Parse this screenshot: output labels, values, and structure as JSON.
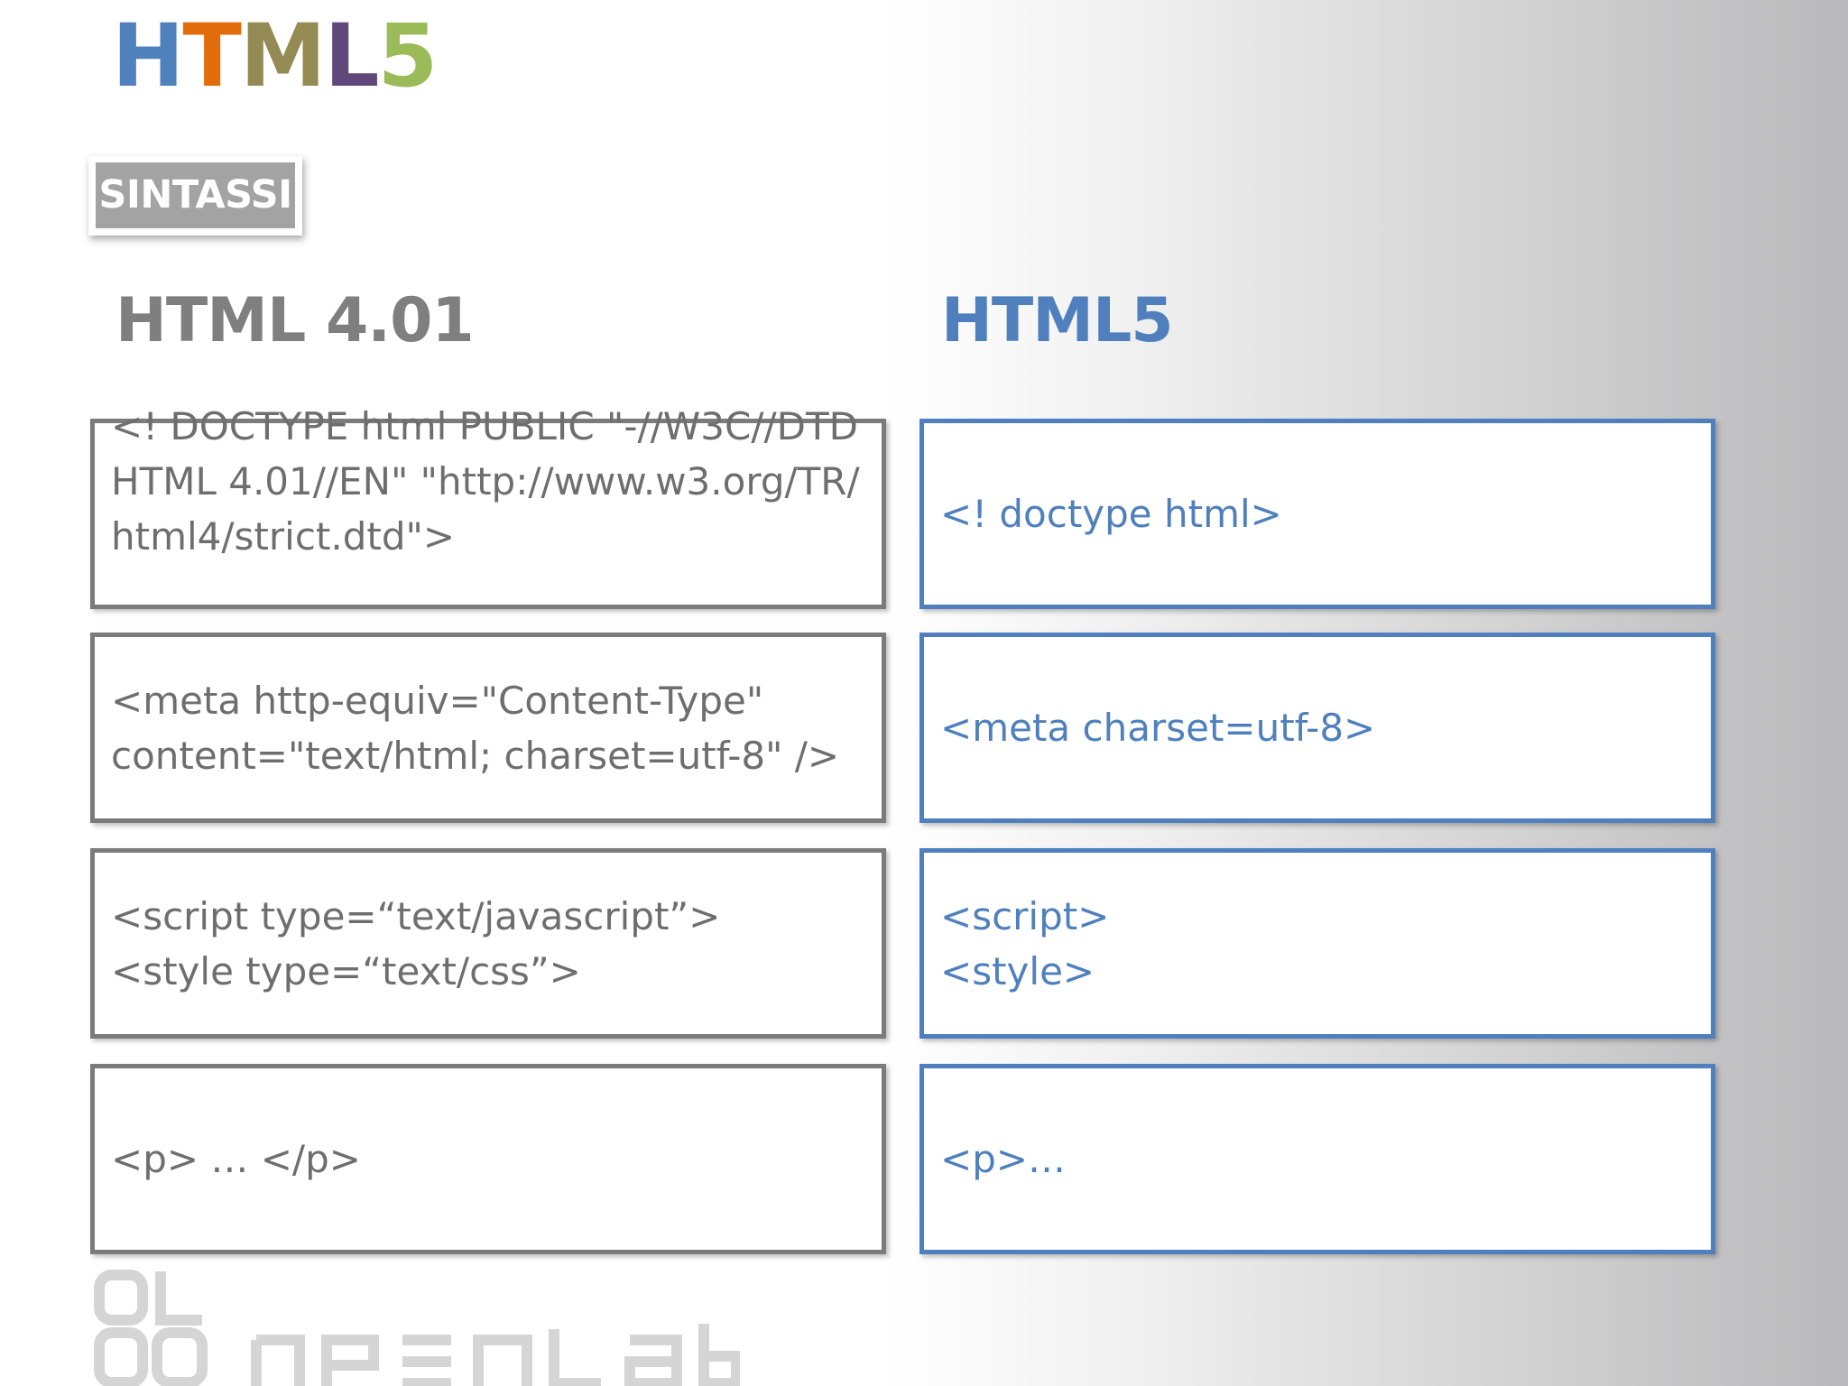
{
  "logo": {
    "letters": [
      "H",
      "T",
      "M",
      "L",
      "5"
    ],
    "colors": [
      "#4f81bd",
      "#e36c0a",
      "#948a54",
      "#60497a",
      "#9bbb59"
    ]
  },
  "section_label": "SINTASSI",
  "columns": {
    "old_title": "HTML 4.01",
    "new_title": "HTML5"
  },
  "rows": [
    {
      "old": "<! DOCTYPE html PUBLIC \"-//W3C//DTD HTML 4.01//EN\" \"http://www.w3.org/TR/html4/strict.dtd\">",
      "new": "<! doctype html>"
    },
    {
      "old": "<meta http-equiv=\"Content-Type\" content=\"text/html; charset=utf-8\" />",
      "new": "<meta charset=utf-8>"
    },
    {
      "old": "<script type=“text/javascript”>\n<style type=“text/css”>",
      "new": "<script>\n<style>"
    },
    {
      "old": "<p> … </p>",
      "new": "<p>…"
    }
  ],
  "brand": {
    "logo_name": "openlab-logo"
  }
}
